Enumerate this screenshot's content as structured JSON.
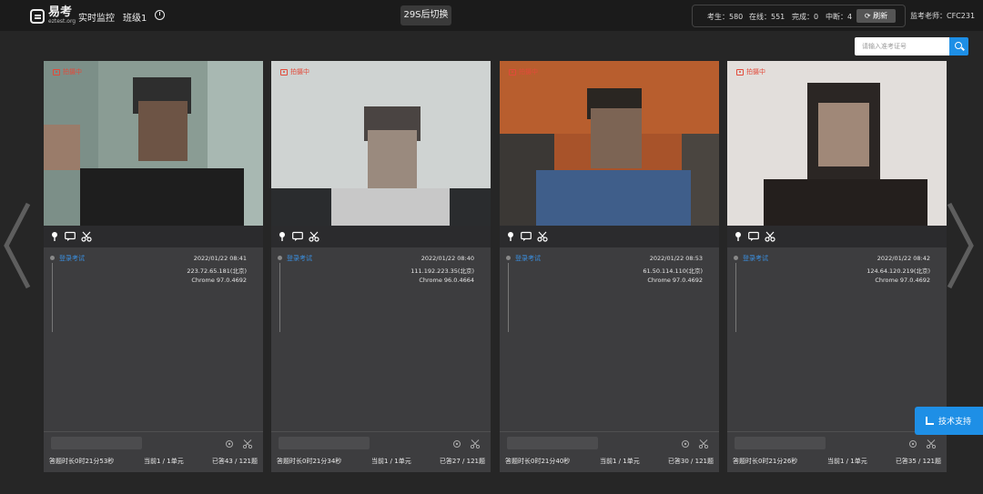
{
  "header": {
    "logo_cn": "易考",
    "logo_en": "eztest.org",
    "nav_monitor": "实时监控",
    "nav_class": "班级1",
    "switch_label": "29S后切换",
    "stats": {
      "examinees": "考生：580",
      "online": "在线：551",
      "completed": "完成：0",
      "interrupted": "中断：4",
      "refresh_label": "刷新"
    },
    "teacher": "监考老师：CFC231"
  },
  "search": {
    "placeholder": "请输入准考证号"
  },
  "support_label": "技术支持",
  "cards": [
    {
      "recording": "拍摄中",
      "status": "登录考试",
      "datetime": "2022/01/22 08:41",
      "ip": "223.72.65.181(北京)",
      "browser": "Chrome 97.0.4692",
      "duration": "答题时长0时21分53秒",
      "unit": "当前1 / 1单元",
      "answered": "已答43 / 121题"
    },
    {
      "recording": "拍摄中",
      "status": "登录考试",
      "datetime": "2022/01/22 08:40",
      "ip": "111.192.223.35(北京)",
      "browser": "Chrome 96.0.4664",
      "duration": "答题时长0时21分34秒",
      "unit": "当前1 / 1单元",
      "answered": "已答27 / 121题"
    },
    {
      "recording": "拍摄中",
      "status": "登录考试",
      "datetime": "2022/01/22 08:53",
      "ip": "61.50.114.110(北京)",
      "browser": "Chrome 97.0.4692",
      "duration": "答题时长0时21分40秒",
      "unit": "当前1 / 1单元",
      "answered": "已答30 / 121题"
    },
    {
      "recording": "拍摄中",
      "status": "登录考试",
      "datetime": "2022/01/22 08:42",
      "ip": "124.64.120.219(北京)",
      "browser": "Chrome 97.0.4692",
      "duration": "答题时长0时21分26秒",
      "unit": "当前1 / 1单元",
      "answered": "已答35 / 121题"
    }
  ]
}
